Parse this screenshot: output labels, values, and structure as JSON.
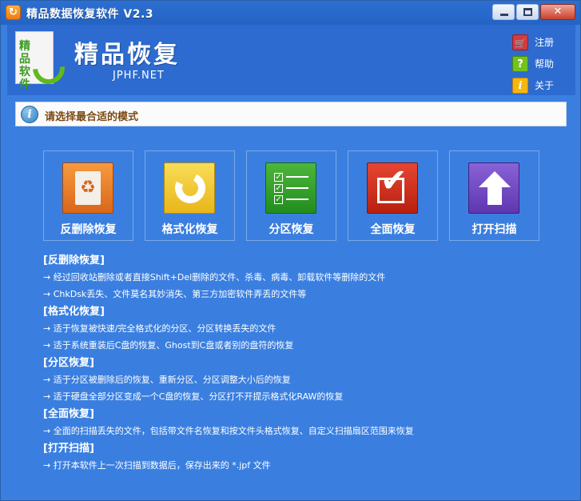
{
  "window": {
    "title": "精品数据恢复软件 V2.3",
    "app_icon_glyph": "↻",
    "controls": {
      "minimize": "minimize",
      "maximize": "maximize",
      "close": "✕"
    }
  },
  "header": {
    "logo_text": "精品软件",
    "brand": "精品恢复",
    "brand_sub": "JPHF.NET",
    "links": [
      {
        "label": "注册",
        "icon": "shopping-cart-icon",
        "glyph": "🛒"
      },
      {
        "label": "帮助",
        "icon": "help-icon",
        "glyph": "?"
      },
      {
        "label": "关于",
        "icon": "info-icon",
        "glyph": "i"
      }
    ]
  },
  "mode_bar": {
    "icon_glyph": "i",
    "text": "请选择最合适的模式"
  },
  "modes": [
    {
      "label": "反删除恢复",
      "icon": "recycle-bin-icon",
      "glyph": "♻"
    },
    {
      "label": "格式化恢复",
      "icon": "refresh-icon"
    },
    {
      "label": "分区恢复",
      "icon": "checklist-icon",
      "glyph": "✓"
    },
    {
      "label": "全面恢复",
      "icon": "checkbox-icon",
      "glyph": "✔"
    },
    {
      "label": "打开扫描",
      "icon": "up-arrow-icon"
    }
  ],
  "descriptions": [
    {
      "title": "[反删除恢复]",
      "lines": [
        "→ 经过回收站删除或者直接Shift+Del删除的文件、杀毒、病毒、卸载软件等删除的文件",
        "→ ChkDsk丢失、文件莫名其妙消失、第三方加密软件弄丢的文件等"
      ]
    },
    {
      "title": "[格式化恢复]",
      "lines": [
        "→ 适于恢复被快速/完全格式化的分区、分区转换丢失的文件",
        "→ 适于系统重装后C盘的恢复、Ghost到C盘或者别的盘符的恢复"
      ]
    },
    {
      "title": "[分区恢复]",
      "lines": [
        "→ 适于分区被删除后的恢复、重新分区、分区调整大小后的恢复",
        "→ 适于硬盘全部分区变成一个C盘的恢复、分区打不开提示格式化RAW的恢复"
      ]
    },
    {
      "title": "[全面恢复]",
      "lines": [
        "→ 全面的扫描丢失的文件，包括带文件名恢复和按文件头格式恢复、自定义扫描扇区范围来恢复"
      ]
    },
    {
      "title": "[打开扫描]",
      "lines": [
        "→ 打开本软件上一次扫描到数据后，保存出来的 *.jpf 文件"
      ]
    }
  ]
}
